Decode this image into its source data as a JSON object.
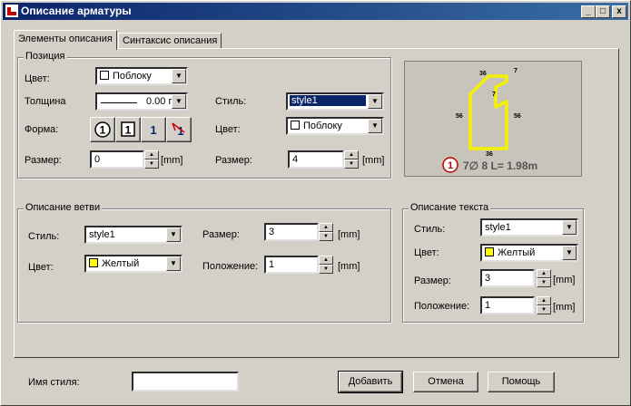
{
  "window": {
    "title": "Описание арматуры",
    "minimize": "_",
    "maximize": "□",
    "close": "x"
  },
  "tabs": [
    {
      "label": "Элементы описания",
      "active": true
    },
    {
      "label": "Синтаксис описания",
      "active": false
    }
  ],
  "position": {
    "legend": "Позиция",
    "color_label": "Цвет:",
    "color_value": "Поблоку",
    "color_swatch": "#ffffff",
    "thickness_label": "Толщина",
    "thickness_value": "0.00 г",
    "style_label": "Стиль:",
    "style_value": "style1",
    "shape_label": "Форма:",
    "shape_buttons": [
      {
        "label": "1",
        "icon": "circled-number-icon"
      },
      {
        "label": "1",
        "icon": "boxed-number-icon"
      },
      {
        "label": "1",
        "icon": "plain-number-icon"
      },
      {
        "label": "1",
        "icon": "crossed-number-icon"
      }
    ],
    "color2_label": "Цвет:",
    "color2_value": "Поблоку",
    "color2_swatch": "#ffffff",
    "size_label": "Размер:",
    "size_value": "0",
    "size_unit": "[mm]",
    "size2_label": "Размер:",
    "size2_value": "4",
    "size2_unit": "[mm]"
  },
  "preview": {
    "dims": {
      "top": "36",
      "corner": "7",
      "inner": "7",
      "left": "56",
      "right": "56",
      "bottom": "36"
    },
    "caption_number": "1",
    "caption_text": "7∅ 8 L= 1.98m",
    "shape_color": "#f2f200"
  },
  "branch": {
    "legend": "Описание ветви",
    "style_label": "Стиль:",
    "style_value": "style1",
    "color_label": "Цвет:",
    "color_value": "Желтый",
    "color_swatch": "#ffff00",
    "size_label": "Размер:",
    "size_value": "3",
    "size_unit": "[mm]",
    "position_label": "Положение:",
    "position_value": "1",
    "position_unit": "[mm]"
  },
  "text": {
    "legend": "Описание текста",
    "style_label": "Стиль:",
    "style_value": "style1",
    "color_label": "Цвет:",
    "color_value": "Желтый",
    "color_swatch": "#ffff00",
    "size_label": "Размер:",
    "size_value": "3",
    "size_unit": "[mm]",
    "position_label": "Положение:",
    "position_value": "1",
    "position_unit": "[mm]"
  },
  "footer": {
    "style_name_label": "Имя стиля:",
    "style_name_value": "",
    "add_label": "Добавить",
    "cancel_label": "Отмена",
    "help_label": "Помощь"
  }
}
